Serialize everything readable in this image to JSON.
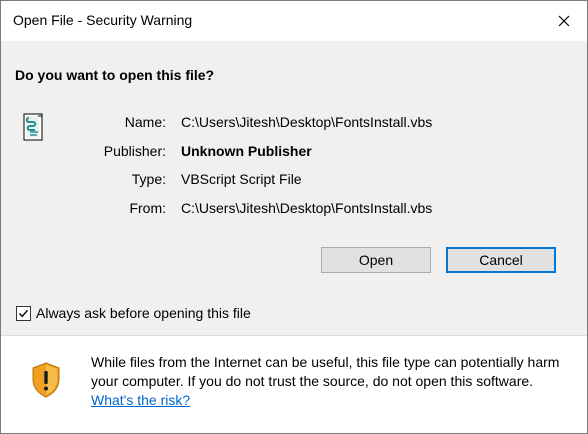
{
  "window": {
    "title": "Open File - Security Warning"
  },
  "dialog": {
    "question": "Do you want to open this file?",
    "fields": [
      {
        "label": "Name:",
        "value": "C:\\Users\\Jitesh\\Desktop\\FontsInstall.vbs"
      },
      {
        "label": "Publisher:",
        "value": "Unknown Publisher"
      },
      {
        "label": "Type:",
        "value": "VBScript Script File"
      },
      {
        "label": "From:",
        "value": "C:\\Users\\Jitesh\\Desktop\\FontsInstall.vbs"
      }
    ],
    "buttons": {
      "open": "Open",
      "cancel": "Cancel"
    },
    "checkbox": {
      "label": "Always ask before opening this file",
      "checked": true
    }
  },
  "warning": {
    "text": "While files from the Internet can be useful, this file type can potentially harm your computer. If you do not trust the source, do not open this software.",
    "link_text": "What's the risk?"
  },
  "icons": {
    "file": "vbscript-file-icon",
    "shield": "security-shield-icon",
    "close": "close-icon",
    "check": "checkmark-icon"
  },
  "colors": {
    "accent": "#0078d7",
    "link": "#0066cc",
    "panel_bg": "#f0f0f0",
    "shield_orange": "#f0a020"
  }
}
